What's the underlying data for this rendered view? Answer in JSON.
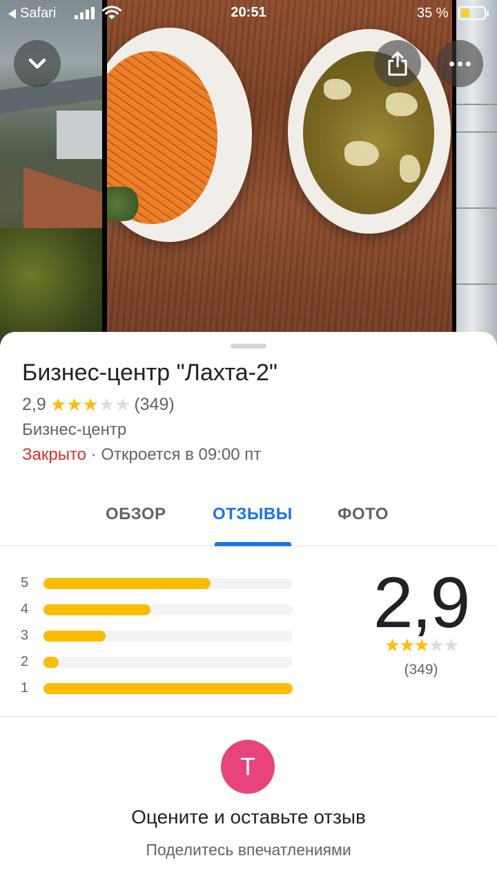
{
  "status_bar": {
    "back_app": "Safari",
    "time": "20:51",
    "battery": "35 %"
  },
  "place": {
    "name": "Бизнес-центр \"Лахта-2\"",
    "rating": "2,9",
    "rating_stars": 3,
    "review_count": "(349)",
    "category": "Бизнес-центр",
    "status": "Закрыто",
    "hours_separator": " · ",
    "hours": "Откроется в 09:00 пт"
  },
  "tabs": [
    {
      "label": "ОБЗОР",
      "active": false
    },
    {
      "label": "ОТЗЫВЫ",
      "active": true
    },
    {
      "label": "ФОТО",
      "active": false
    }
  ],
  "histogram": [
    {
      "stars": "5",
      "fraction": 0.67
    },
    {
      "stars": "4",
      "fraction": 0.43
    },
    {
      "stars": "3",
      "fraction": 0.25
    },
    {
      "stars": "2",
      "fraction": 0.06
    },
    {
      "stars": "1",
      "fraction": 1.0
    }
  ],
  "summary": {
    "rating": "2,9",
    "count": "(349)"
  },
  "review_prompt": {
    "avatar_letter": "T",
    "avatar_color": "#e8437c",
    "title": "Оцените и оставьте отзыв",
    "subtitle": "Поделитесь впечатлениями"
  },
  "colors": {
    "accent": "#1a73e8",
    "star": "#fbbc04",
    "closed": "#d93025"
  },
  "icons": {
    "collapse": "chevron-down-icon",
    "share": "share-icon",
    "more": "more-dots-icon"
  }
}
